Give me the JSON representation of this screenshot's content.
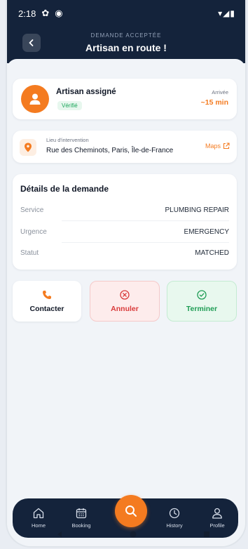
{
  "status_bar": {
    "time": "2:18",
    "signal": "▾◢▮"
  },
  "header": {
    "subtitle": "DEMANDE ACCEPTÉE",
    "title": "Artisan en route !"
  },
  "artisan": {
    "name": "Artisan assigné",
    "badge": "Vérifié",
    "arrival_label": "Arrivée",
    "arrival_value": "~15 min"
  },
  "location": {
    "label": "Lieu d'intervention",
    "address": "Rue des Cheminots, Paris, Île-de-France",
    "maps_label": "Maps"
  },
  "details": {
    "title": "Détails de la demande",
    "rows": [
      {
        "label": "Service",
        "value": "PLUMBING REPAIR"
      },
      {
        "label": "Urgence",
        "value": "EMERGENCY"
      },
      {
        "label": "Statut",
        "value": "MATCHED"
      }
    ]
  },
  "actions": {
    "contact": "Contacter",
    "cancel": "Annuler",
    "finish": "Terminer"
  },
  "nav": {
    "home": "Home",
    "booking": "Booking",
    "history": "History",
    "profile": "Profile"
  },
  "colors": {
    "brand_orange": "#f47b20",
    "header_navy": "#14233b",
    "success_green": "#1f9d55",
    "danger_red": "#d93a3a"
  },
  "icons": [
    "back-icon",
    "user-icon",
    "pin-icon",
    "external-link-icon",
    "phone-icon",
    "close-circle-icon",
    "check-circle-icon",
    "home-icon",
    "calendar-icon",
    "search-icon",
    "clock-icon",
    "profile-icon"
  ]
}
